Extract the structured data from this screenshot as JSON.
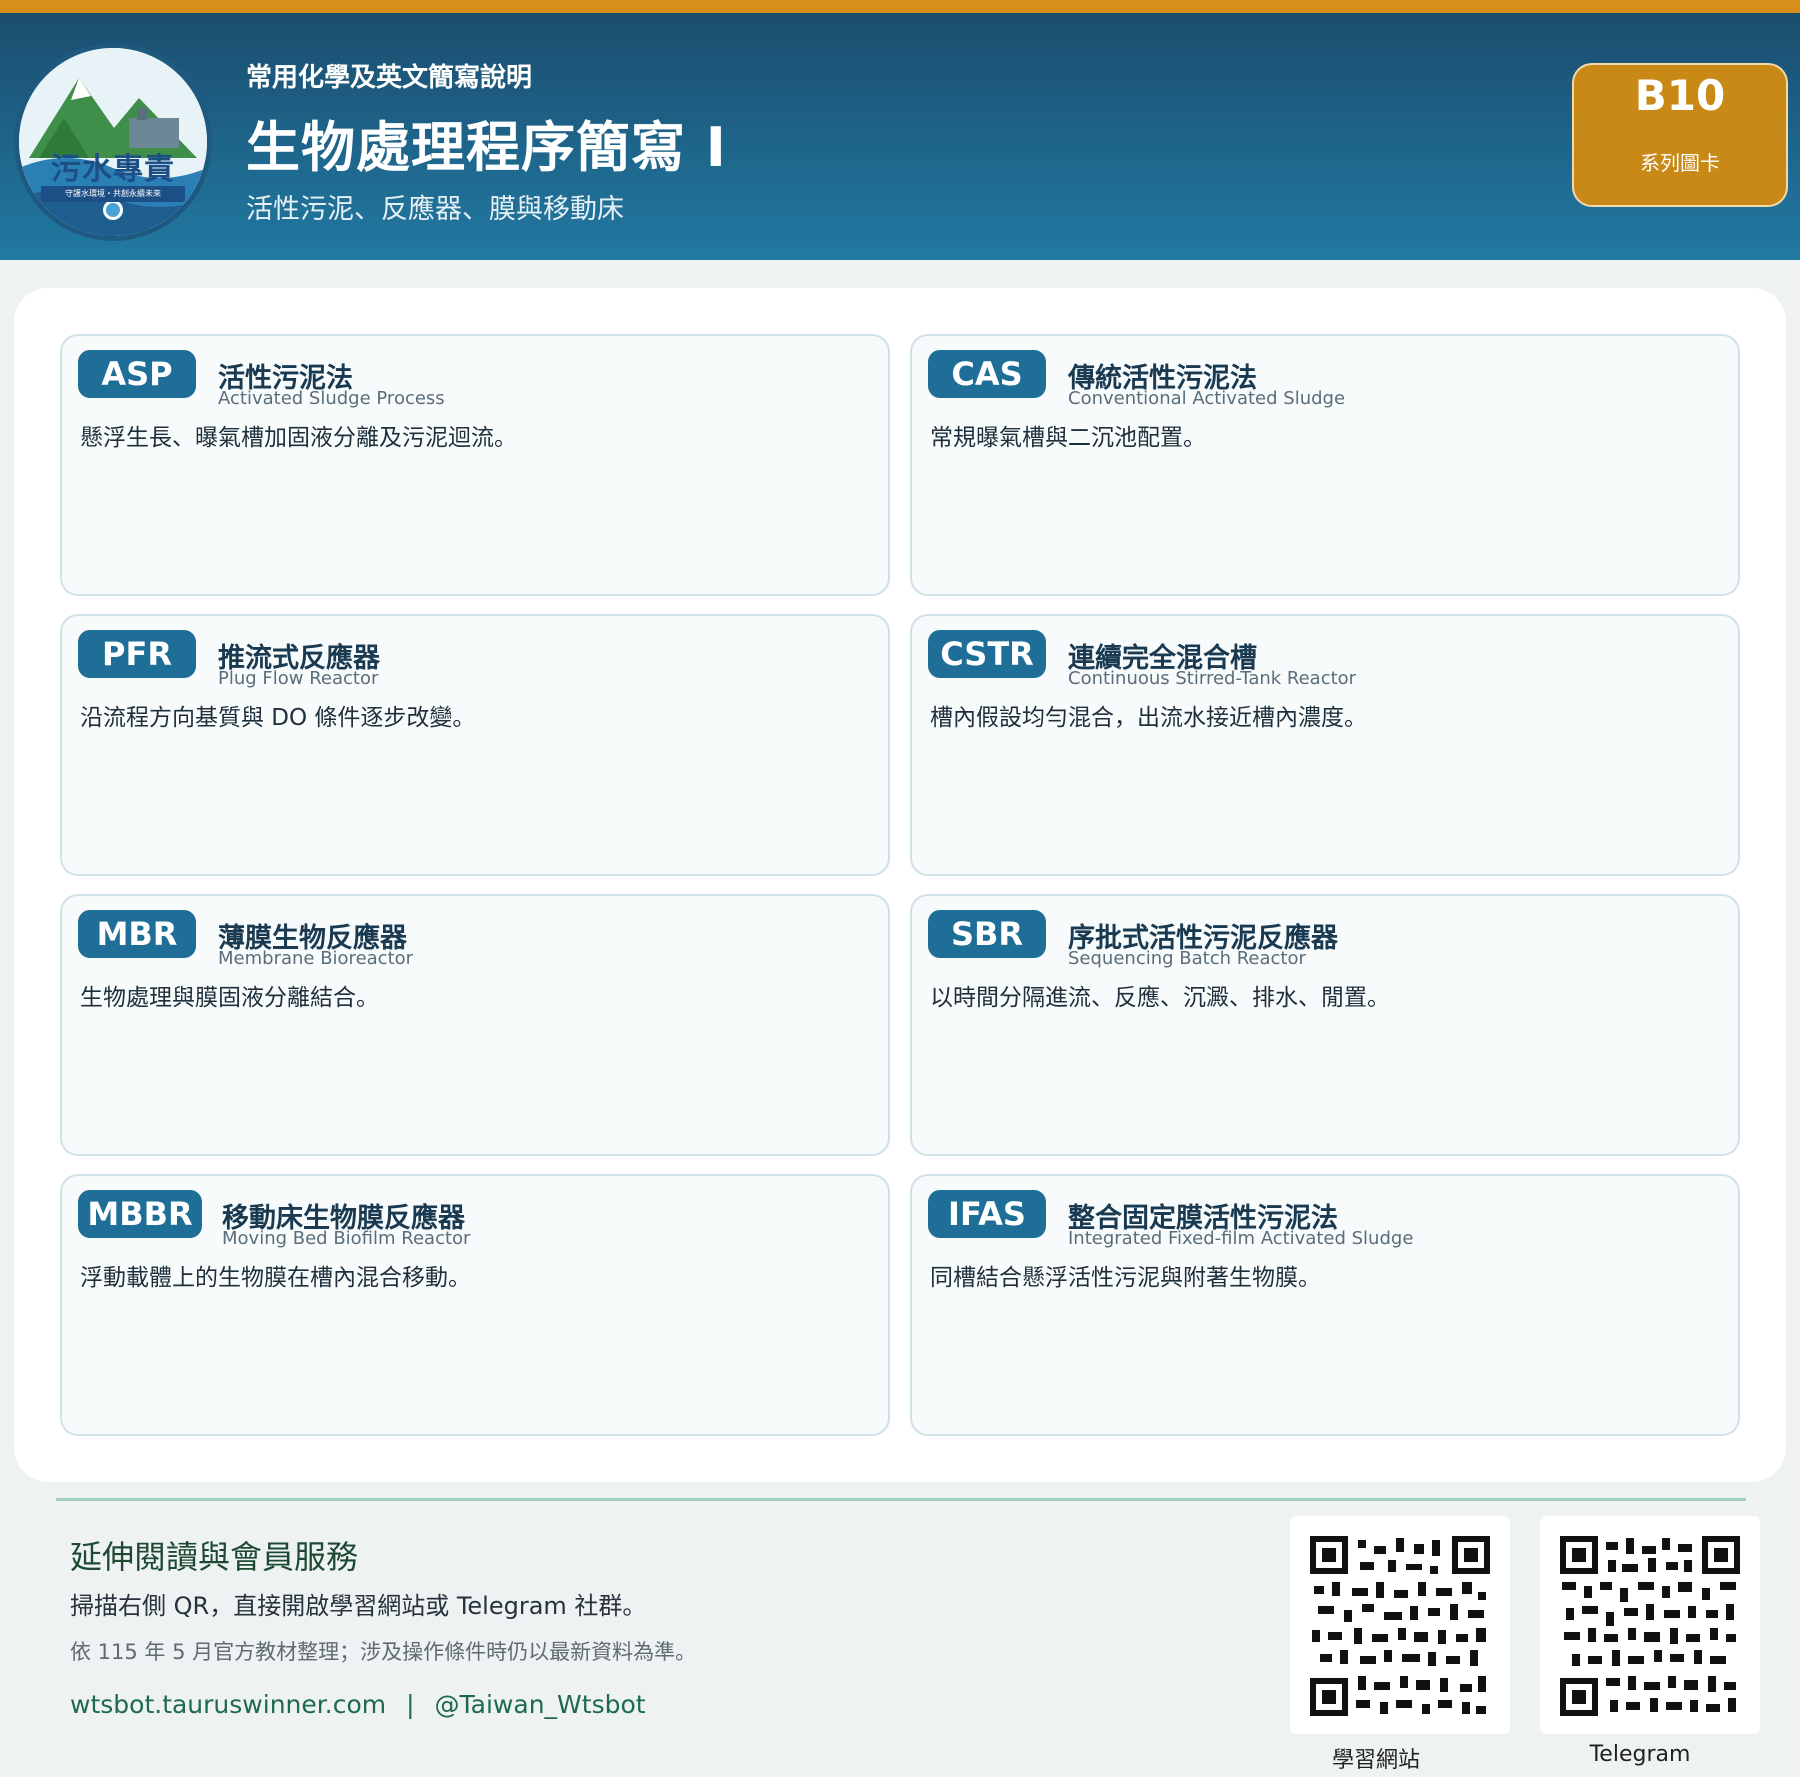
{
  "header": {
    "logo_text": "污水專責",
    "logo_sub": "守護水環境・共創永續未來",
    "supertitle": "常用化學及英文簡寫說明",
    "title": "生物處理程序簡寫 I",
    "subtitle": "活性污泥、反應器、膜與移動床",
    "badge_code": "B10",
    "badge_label": "系列圖卡"
  },
  "cards": [
    {
      "abbr": "ASP",
      "zh": "活性污泥法",
      "en": "Activated Sludge Process",
      "desc": "懸浮生長、曝氣槽加固液分離及污泥迴流。"
    },
    {
      "abbr": "CAS",
      "zh": "傳統活性污泥法",
      "en": "Conventional Activated Sludge",
      "desc": "常規曝氣槽與二沉池配置。"
    },
    {
      "abbr": "PFR",
      "zh": "推流式反應器",
      "en": "Plug Flow Reactor",
      "desc": "沿流程方向基質與 DO 條件逐步改變。"
    },
    {
      "abbr": "CSTR",
      "zh": "連續完全混合槽",
      "en": "Continuous Stirred-Tank Reactor",
      "desc": "槽內假設均勻混合，出流水接近槽內濃度。"
    },
    {
      "abbr": "MBR",
      "zh": "薄膜生物反應器",
      "en": "Membrane Bioreactor",
      "desc": "生物處理與膜固液分離結合。"
    },
    {
      "abbr": "SBR",
      "zh": "序批式活性污泥反應器",
      "en": "Sequencing Batch Reactor",
      "desc": "以時間分隔進流、反應、沉澱、排水、閒置。"
    },
    {
      "abbr": "MBBR",
      "zh": "移動床生物膜反應器",
      "en": "Moving Bed Biofilm Reactor",
      "desc": "浮動載體上的生物膜在槽內混合移動。"
    },
    {
      "abbr": "IFAS",
      "zh": "整合固定膜活性污泥法",
      "en": "Integrated Fixed-film Activated Sludge",
      "desc": "同槽結合懸浮活性污泥與附著生物膜。"
    }
  ],
  "footer": {
    "title": "延伸閱讀與會員服務",
    "desc": "掃描右側 QR，直接開啟學習網站或 Telegram 社群。",
    "note": "依 115 年 5 月官方教材整理；涉及操作條件時仍以最新資料為準。",
    "website": "wtsbot.tauruswinner.com",
    "separator": "|",
    "telegram_handle": "@Taiwan_Wtsbot",
    "qr_labels": [
      "學習網站",
      "Telegram"
    ]
  }
}
